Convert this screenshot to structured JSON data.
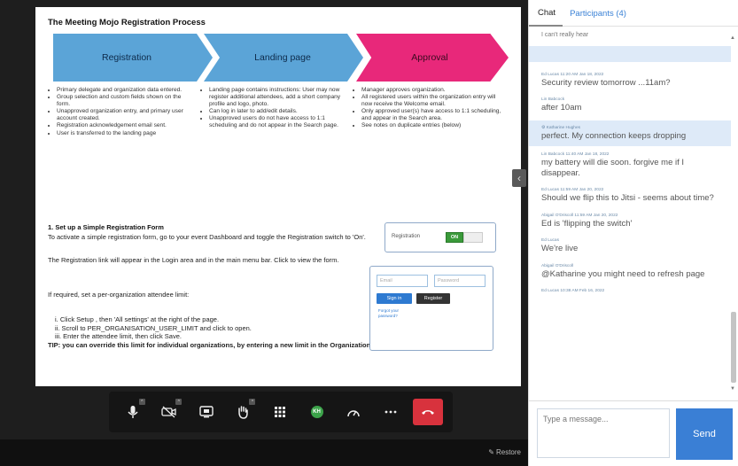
{
  "slide": {
    "title": "The Meeting Mojo Registration Process",
    "stages": [
      "Registration",
      "Landing page",
      "Approval"
    ],
    "columns": [
      [
        "Primary delegate and organization data entered.",
        "Group selection and custom fields shown on the form.",
        "Unapproved organization entry, and primary user account created.",
        "Registration acknowledgement email sent.",
        "User is transferred to the landing page"
      ],
      [
        "Landing page contains instructions: User may now register additional attendees, add a short company profile and logo, photo.",
        "Can log in later to add/edit details.",
        "Unapproved users do not have access to 1:1 scheduling and do not appear in the Search page."
      ],
      [
        "Manager approves organization.",
        "All registered users within the organization entry will now receive the Welcome email.",
        "Only approved user(s) have access to 1:1 scheduling, and appear in the Search area.",
        "See notes on duplicate entries (below)"
      ]
    ],
    "section_heading": "1.  Set up a Simple Registration Form",
    "para1": "To activate a simple registration form, go to your event Dashboard  and toggle the Registration switch to 'On'.",
    "para2": "The Registration link will appear in the Login area and in the main menu bar. Click to view the form.",
    "para3": "If required, set a per-organization attendee limit:",
    "steps": [
      "i.   Click  Setup , then 'All settings' at the right of the page.",
      "ii.  Scroll to PER_ORGANISATION_USER_LIMIT and click to open.",
      "iii. Enter the attendee limit, then click Save."
    ],
    "tip": "TIP: you can override this limit for individual organizations, by entering a new limit in the Organization View page.",
    "widget_registration": {
      "label": "Registration",
      "on": "ON"
    },
    "widget_login": {
      "email": "Email",
      "password": "Password",
      "signin": "Sign in",
      "register": "Register",
      "forgot": "Forgot your password?"
    }
  },
  "toolbar": {
    "icons": [
      "microphone-icon",
      "camera-off-icon",
      "screenshare-icon",
      "raise-hand-icon",
      "tile-view-icon",
      "avatar",
      "speed-icon",
      "more-icon",
      "hangup-icon"
    ],
    "avatar_initials": "KH"
  },
  "bottom": {
    "restore_label": "Restore"
  },
  "sidebar": {
    "tabs": {
      "chat": "Chat",
      "participants": "Participants (4)"
    },
    "top_cut_text": "I can't really hear",
    "messages": [
      {
        "meta": "Ed Lucas  11:20 AM Jan 18, 2022",
        "text": "Security review tomorrow ...11am?",
        "highlight": false
      },
      {
        "meta": "Lin Babcock",
        "text": "after 10am",
        "highlight": false
      },
      {
        "meta": "Katharine Hughes",
        "text": "perfect. My connection keeps dropping",
        "highlight": true
      },
      {
        "meta": "Lin Babcock  11:40 AM Jan 18, 2022",
        "text": "my battery will die soon. forgive me if I disappear.",
        "highlight": false
      },
      {
        "meta": "Ed Lucas  11:59 AM Jan 20, 2022",
        "text": "Should we flip this to Jitsi - seems about time?",
        "highlight": false
      },
      {
        "meta": "Abigail O'Driscoll  11:59 AM Jan 20, 2022",
        "text": "Ed is 'flipping the switch'",
        "highlight": false
      },
      {
        "meta": "Ed Lucas",
        "text": "We're live",
        "highlight": false
      },
      {
        "meta": "Abigail O'Driscoll",
        "text": "@Katharine you might need to refresh page",
        "highlight": false
      },
      {
        "meta": "Ed Lucas  10:38 AM Feb 16, 2022",
        "text": "",
        "highlight": false
      }
    ],
    "compose_placeholder": "Type a message...",
    "send_label": "Send"
  },
  "colors": {
    "chevron_blue": "#5ba4d7",
    "chevron_pink": "#e8287a",
    "send_blue": "#3a7fd5",
    "hangup_red": "#d8323d",
    "highlight_bg": "#deeaf8"
  }
}
